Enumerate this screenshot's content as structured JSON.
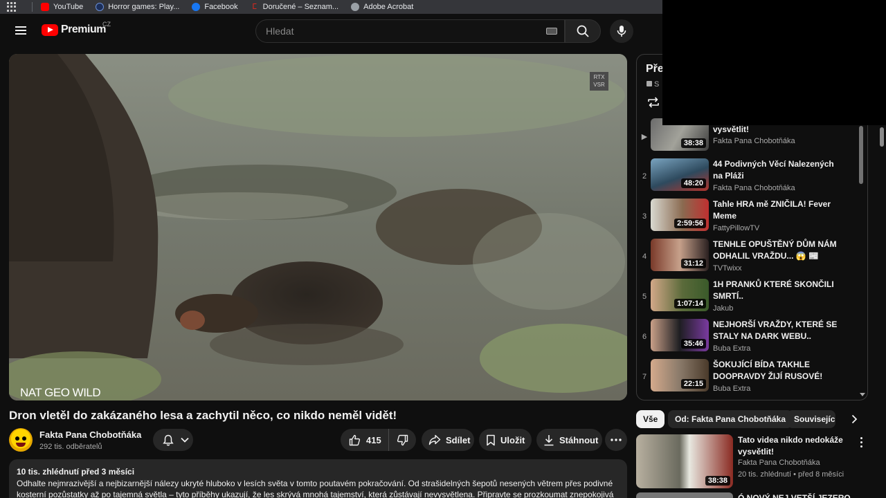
{
  "bookmarks": [
    {
      "label": "YouTube",
      "icon": "youtube-icon",
      "color": "#ff0000"
    },
    {
      "label": "Horror games: Play...",
      "icon": "globe-icon",
      "color": "#2a5db0"
    },
    {
      "label": "Facebook",
      "icon": "facebook-icon",
      "color": "#1877f2"
    },
    {
      "label": "Doručené – Seznam...",
      "icon": "seznam-icon",
      "color": "#d6281f"
    },
    {
      "label": "Adobe Acrobat",
      "icon": "acrobat-icon",
      "color": "#9aa0a6"
    }
  ],
  "header": {
    "logo_text": "Premium",
    "country": "CZ",
    "search_placeholder": "Hledat"
  },
  "player": {
    "watermark": "NAT GEO WILD",
    "badge": [
      "RTX",
      "VSR"
    ]
  },
  "video": {
    "title": "Dron vletěl do zakázaného lesa a zachytil něco, co nikdo neměl vidět!",
    "channel": "Fakta Pana Chobotňáka",
    "subscribers": "292 tis. odběratelů",
    "likes": "415",
    "share": "Sdílet",
    "save": "Uložit",
    "download": "Stáhnout"
  },
  "description": {
    "meta": "10 tis. zhlédnutí  před 3 měsíci",
    "text": "Odhalte nejmrazivější a nejbizarnější nálezy ukryté hluboko v lesích světa v tomto poutavém pokračování. Od strašidelných šepotů nesených větrem přes podivné kosterní pozůstatky až po tajemná světla – tyto příběhy ukazují, že les skrývá mnohá tajemství, která zůstávají nevysvětlena. Připravte se prozkoumat znepokojivá místa"
  },
  "playlist": {
    "title_fragment": "Pře",
    "sub_fragment": "S",
    "items": [
      {
        "index": "▶",
        "title": "Tato videa nikdo nedokáže vysvětlit!",
        "channel": "Fakta Pana Chobotňáka",
        "duration": "38:38"
      },
      {
        "index": "2",
        "title": "44 Podivných Věcí Nalezených na Pláži",
        "channel": "Fakta Pana Chobotňáka",
        "duration": "48:20"
      },
      {
        "index": "3",
        "title": "Tahle HRA mě ZNIČILA! Fever Meme",
        "channel": "FattyPillowTV",
        "duration": "2:59:56"
      },
      {
        "index": "4",
        "title": "TENHLE OPUŠTĚNÝ DŮM NÁM ODHALIL VRAŽDU... 😱 📰",
        "channel": "TVTwixx",
        "duration": "31:12"
      },
      {
        "index": "5",
        "title": "1H PRANKŮ KTERÉ SKONČILI SMRTÍ..",
        "channel": "Jakub",
        "duration": "1:07:14"
      },
      {
        "index": "6",
        "title": "NEJHORŠÍ VRAŽDY, KTERÉ SE STALY NA DARK WEBU..",
        "channel": "Buba Extra",
        "duration": "35:46"
      },
      {
        "index": "7",
        "title": "ŠOKUJÍCÍ BÍDA TAKHLE DOOPRAVDY ŽIJÍ RUSOVÉ!",
        "channel": "Buba Extra",
        "duration": "22:15"
      }
    ]
  },
  "chips": [
    "Vše",
    "Od: Fakta Pana Chobotňáka",
    "Související"
  ],
  "recommendation": {
    "title": "Tato videa nikdo nedokáže vysvětlit!",
    "channel": "Fakta Pana Chobotňáka",
    "meta": "20 tis. zhlédnutí  • před 8 měsíci",
    "duration": "38:38"
  },
  "recommendation2": {
    "title_fragment": "Ó  NOVÝ  NEJ  VETŠÍ  JEZERO..."
  },
  "colors": {
    "background": "#0f0f0f",
    "surface": "#272727",
    "brand_red": "#ff0000",
    "secondary_text": "#aaaaaa"
  }
}
